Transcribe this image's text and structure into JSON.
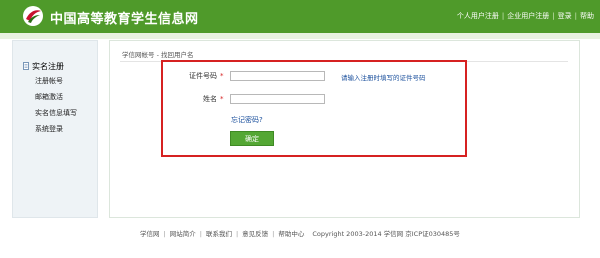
{
  "header": {
    "site_title": "中国高等教育学生信息网",
    "nav": [
      "个人用户注册",
      "企业用户注册",
      "登录",
      "帮助"
    ],
    "logo_icon": "chsi-logo-icon"
  },
  "sidebar": {
    "title": "实名注册",
    "items": [
      "注册帐号",
      "邮箱激活",
      "实名信息填写",
      "系统登录"
    ]
  },
  "main": {
    "breadcrumb": "学信网帐号 - 找回用户名",
    "form": {
      "id_label": "证件号码",
      "id_value": "",
      "id_hint": "请输入注册时填写的证件号码",
      "name_label": "姓名",
      "name_value": "",
      "required_mark": "*",
      "forgot_link": "忘记密码?",
      "submit_label": "确定"
    }
  },
  "footer": {
    "links": [
      "学信网",
      "网站简介",
      "联系我们",
      "意见反馈",
      "帮助中心"
    ],
    "copyright": "Copyright 2003-2014 学信网 京ICP证030485号"
  },
  "colors": {
    "brand_green": "#4f9a2a",
    "highlight_red": "#d62121",
    "link_blue": "#1a4f9c"
  }
}
